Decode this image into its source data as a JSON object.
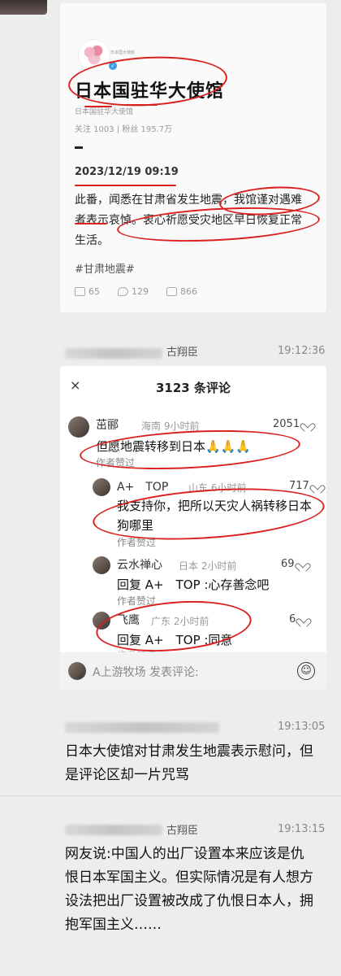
{
  "post": {
    "logo_caption": "日本国大使館",
    "verified_mark": "✓",
    "account_name": "日本国驻华大使馆",
    "account_handle": "日本国驻华大使馆",
    "stats": "关注 1003 | 粉丝 195.7万",
    "date": "2023/12/19  09:19",
    "body": "此番，闻悉在甘肃省发生地震，我馆谨对遇难者表示哀悼。衷心祈愿受灾地区早日恢复正常生活。",
    "hashtag": "#甘肃地震#",
    "shares": "65",
    "comments": "129",
    "likes": "866"
  },
  "chat": [
    {
      "sender": "古翔臣",
      "time": "19:12:36"
    },
    {
      "sender": "",
      "time": "19:13:05",
      "text": "日本大使馆对甘肃发生地震表示慰问，但是评论区却一片咒骂"
    },
    {
      "sender": "古翔臣",
      "time": "19:13:15",
      "text": "网友说:中国人的出厂设置本来应该是仇恨日本军国主义。但实际情况是有人想方设法把出厂设置被改成了仇恨日本人，拥抱军国主义……"
    }
  ],
  "comments_panel": {
    "close_label": "×",
    "title": "3123 条评论",
    "items": [
      {
        "name": "茁郦",
        "meta": "海南 9小时前",
        "likes": "2051",
        "text": "但愿地震转移到日本🙏🙏🙏",
        "liked": "作者赞过"
      },
      {
        "name": "A+　TOP",
        "meta": "山东 6小时前",
        "likes": "717",
        "text": "我支持你，把所以天灾人祸转移日本狗哪里",
        "liked": "作者赞过"
      },
      {
        "name": "云水禅心",
        "meta": "日本 2小时前",
        "likes": "69",
        "text": "回复 A+　TOP :心存善念吧",
        "liked": "作者赞过"
      },
      {
        "name": "飞鹰",
        "meta": "广东 2小时前",
        "likes": "6",
        "text": "回复 A+　TOP :同意",
        "liked": "作者赞过"
      }
    ],
    "input_placeholder": "A上游牧场 发表评论:",
    "emoji_label": "☺"
  },
  "colors": {
    "annotation_red": "#d9211f",
    "background": "#ededed",
    "verified_blue": "#3f9be0"
  }
}
